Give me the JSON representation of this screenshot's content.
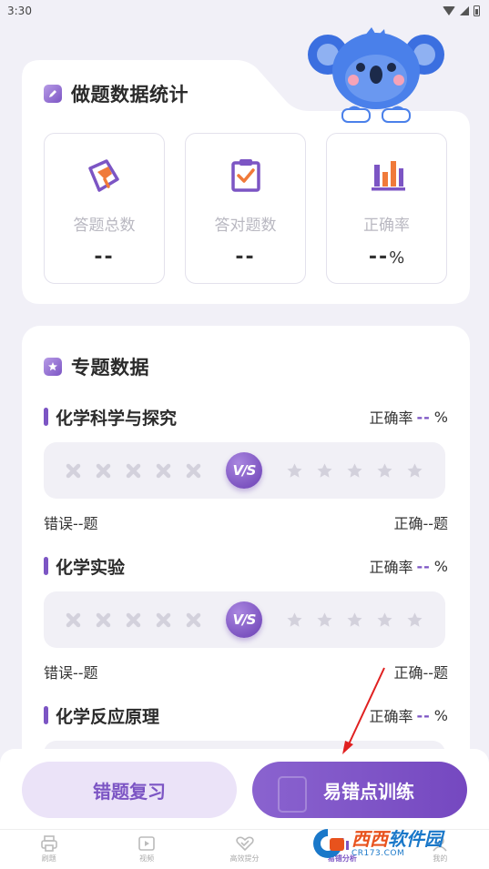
{
  "status_bar": {
    "time": "3:30"
  },
  "stats_card": {
    "title": "做题数据统计",
    "items": [
      {
        "label": "答题总数",
        "value": "--",
        "unit": ""
      },
      {
        "label": "答对题数",
        "value": "--",
        "unit": ""
      },
      {
        "label": "正确率",
        "value": "--",
        "unit": "%"
      }
    ]
  },
  "topic_card": {
    "title": "专题数据",
    "topics": [
      {
        "name": "化学科学与探究",
        "accuracy_label": "正确率",
        "accuracy_value": "--",
        "accuracy_unit": "%",
        "vs_label": "V/S",
        "wrong": "错误--题",
        "correct": "正确--题"
      },
      {
        "name": "化学实验",
        "accuracy_label": "正确率",
        "accuracy_value": "--",
        "accuracy_unit": "%",
        "vs_label": "V/S",
        "wrong": "错误--题",
        "correct": "正确--题"
      },
      {
        "name": "化学反应原理",
        "accuracy_label": "正确率",
        "accuracy_value": "--",
        "accuracy_unit": "%"
      }
    ]
  },
  "actions": {
    "review_label": "错题复习",
    "train_label": "易错点训练"
  },
  "tab_bar": {
    "tabs": [
      {
        "label": "刷题",
        "icon": "printer-icon"
      },
      {
        "label": "视频",
        "icon": "video-icon"
      },
      {
        "label": "高效提分",
        "icon": "heart-icon"
      },
      {
        "label": "易错分析",
        "icon": "chart-icon"
      },
      {
        "label": "我的",
        "icon": "user-icon"
      }
    ],
    "active_index": 3
  },
  "watermark": {
    "brand_a": "西西",
    "brand_b": "软件园",
    "url": "CR173.COM"
  },
  "colors": {
    "accent": "#7c55c4",
    "background": "#f1f0f7",
    "annotation": "#e02020"
  }
}
